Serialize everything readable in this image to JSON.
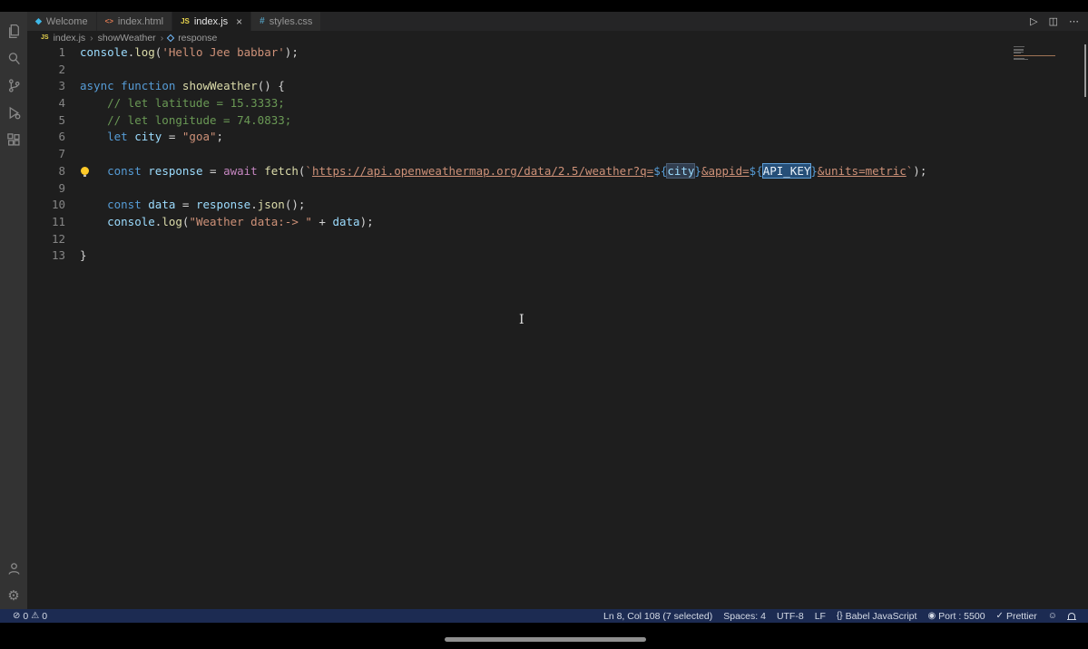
{
  "colors": {
    "editor_bg": "#1e1e1e",
    "activity_bar_bg": "#333333",
    "tab_bar_bg": "#252526",
    "status_bar_bg": "#1c2b52",
    "selection_bg": "#264f78",
    "keyword": "#569cd6",
    "string": "#ce9178",
    "comment": "#6a9955",
    "function": "#dcdcaa",
    "variable": "#9cdcfe"
  },
  "icons": {
    "run": "▷",
    "split_editor": "◫",
    "more": "⋯",
    "close": "×",
    "error": "⊘",
    "warning": "⚠",
    "language": "{}",
    "broadcast": "◉",
    "check": "✓",
    "feedback": "☺",
    "gear": "⚙",
    "breadcrumb_sep": "›",
    "welcome_tab": "◆",
    "html_tab": "<>",
    "js_tab": "JS",
    "css_tab": "#"
  },
  "tab_bar": {
    "tabs": [
      {
        "label": "Welcome"
      },
      {
        "label": "index.html"
      },
      {
        "label": "index.js"
      },
      {
        "label": "styles.css"
      }
    ]
  },
  "breadcrumb": {
    "file_icon": "JS",
    "items": [
      "index.js",
      "showWeather",
      "response"
    ]
  },
  "code": {
    "lines": [
      {
        "num": 1,
        "tokens": [
          {
            "t": "console",
            "c": "var"
          },
          {
            "t": ".",
            "c": "plain"
          },
          {
            "t": "log",
            "c": "fn"
          },
          {
            "t": "(",
            "c": "plain"
          },
          {
            "t": "'Hello Jee babbar'",
            "c": "str"
          },
          {
            "t": ");",
            "c": "plain"
          }
        ]
      },
      {
        "num": 2,
        "tokens": []
      },
      {
        "num": 3,
        "tokens": [
          {
            "t": "async",
            "c": "kw"
          },
          {
            "t": " ",
            "c": "plain"
          },
          {
            "t": "function",
            "c": "kw"
          },
          {
            "t": " ",
            "c": "plain"
          },
          {
            "t": "showWeather",
            "c": "fn"
          },
          {
            "t": "() {",
            "c": "plain"
          }
        ]
      },
      {
        "num": 4,
        "tokens": [
          {
            "t": "    // let latitude = 15.3333;",
            "c": "cmt"
          }
        ]
      },
      {
        "num": 5,
        "tokens": [
          {
            "t": "    // let longitude = 74.0833;",
            "c": "cmt"
          }
        ]
      },
      {
        "num": 6,
        "tokens": [
          {
            "t": "    ",
            "c": "plain"
          },
          {
            "t": "let",
            "c": "kw"
          },
          {
            "t": " ",
            "c": "plain"
          },
          {
            "t": "city",
            "c": "var"
          },
          {
            "t": " = ",
            "c": "plain"
          },
          {
            "t": "\"goa\"",
            "c": "str"
          },
          {
            "t": ";",
            "c": "plain"
          }
        ]
      },
      {
        "num": 7,
        "tokens": []
      },
      {
        "num": 8,
        "bulb": true,
        "tokens": [
          {
            "t": "    ",
            "c": "plain"
          },
          {
            "t": "const",
            "c": "kw"
          },
          {
            "t": " ",
            "c": "plain"
          },
          {
            "t": "response",
            "c": "var"
          },
          {
            "t": " = ",
            "c": "plain"
          },
          {
            "t": "await",
            "c": "ctrl"
          },
          {
            "t": " ",
            "c": "plain"
          },
          {
            "t": "fetch",
            "c": "fn"
          },
          {
            "t": "(",
            "c": "plain"
          },
          {
            "t": "`",
            "c": "str"
          },
          {
            "t": "https://api.openweathermap.org/data/2.5/weather?q=",
            "c": "str strl"
          },
          {
            "t": "${",
            "c": "interp"
          },
          {
            "t": "city",
            "c": "var hl"
          },
          {
            "t": "}",
            "c": "interp"
          },
          {
            "t": "&appid=",
            "c": "str strl"
          },
          {
            "t": "${",
            "c": "interp"
          },
          {
            "t": "API_KEY",
            "c": "var sel"
          },
          {
            "t": "}",
            "c": "interp"
          },
          {
            "t": "&units=metric",
            "c": "str strl"
          },
          {
            "t": "`",
            "c": "str"
          },
          {
            "t": ");",
            "c": "plain"
          }
        ]
      },
      {
        "num": 9,
        "tokens": []
      },
      {
        "num": 10,
        "tokens": [
          {
            "t": "    ",
            "c": "plain"
          },
          {
            "t": "const",
            "c": "kw"
          },
          {
            "t": " ",
            "c": "plain"
          },
          {
            "t": "data",
            "c": "var"
          },
          {
            "t": " = ",
            "c": "plain"
          },
          {
            "t": "response",
            "c": "var"
          },
          {
            "t": ".",
            "c": "plain"
          },
          {
            "t": "json",
            "c": "fn"
          },
          {
            "t": "();",
            "c": "plain"
          }
        ]
      },
      {
        "num": 11,
        "tokens": [
          {
            "t": "    ",
            "c": "plain"
          },
          {
            "t": "console",
            "c": "var"
          },
          {
            "t": ".",
            "c": "plain"
          },
          {
            "t": "log",
            "c": "fn"
          },
          {
            "t": "(",
            "c": "plain"
          },
          {
            "t": "\"Weather data:-> \"",
            "c": "str"
          },
          {
            "t": " + ",
            "c": "plain"
          },
          {
            "t": "data",
            "c": "var"
          },
          {
            "t": ");",
            "c": "plain"
          }
        ]
      },
      {
        "num": 12,
        "tokens": []
      },
      {
        "num": 13,
        "tokens": [
          {
            "t": "}",
            "c": "plain"
          }
        ]
      }
    ]
  },
  "status_bar": {
    "errors": "0",
    "warnings": "0",
    "cursor_position": "Ln 8, Col 108 (7 selected)",
    "indentation": "Spaces: 4",
    "encoding": "UTF-8",
    "eol": "LF",
    "language_mode": "Babel JavaScript",
    "live_server": "Port : 5500",
    "formatter": "Prettier"
  }
}
